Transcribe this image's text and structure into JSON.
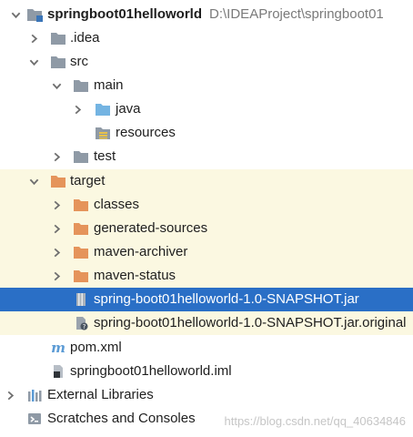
{
  "colors": {
    "folder": "#8f9aa6",
    "source_folder": "#74b4e2",
    "excluded_folder": "#e5945b",
    "selection": "#2a6fc6",
    "excluded_row": "#fbf8e1"
  },
  "tree": {
    "root": {
      "label": "springboot01helloworld",
      "path": "D:\\IDEAProject\\springboot01",
      "icon": "module-folder-icon"
    },
    "idea": {
      "label": ".idea",
      "icon": "folder-icon"
    },
    "src": {
      "label": "src",
      "icon": "folder-icon"
    },
    "main": {
      "label": "main",
      "icon": "folder-icon"
    },
    "java": {
      "label": "java",
      "icon": "source-folder-icon"
    },
    "resources": {
      "label": "resources",
      "icon": "resources-folder-icon"
    },
    "test": {
      "label": "test",
      "icon": "folder-icon"
    },
    "target": {
      "label": "target",
      "icon": "excluded-folder-icon"
    },
    "classes": {
      "label": "classes",
      "icon": "excluded-folder-icon"
    },
    "generated_sources": {
      "label": "generated-sources",
      "icon": "excluded-folder-icon"
    },
    "maven_archiver": {
      "label": "maven-archiver",
      "icon": "excluded-folder-icon"
    },
    "maven_status": {
      "label": "maven-status",
      "icon": "excluded-folder-icon"
    },
    "jar": {
      "label": "spring-boot01helloworld-1.0-SNAPSHOT.jar",
      "icon": "jar-file-icon"
    },
    "jar_original": {
      "label": "spring-boot01helloworld-1.0-SNAPSHOT.jar.original",
      "icon": "unknown-file-icon"
    },
    "pom": {
      "label": "pom.xml",
      "icon": "maven-icon"
    },
    "iml": {
      "label": "springboot01helloworld.iml",
      "icon": "iml-file-icon"
    },
    "external_libraries": {
      "label": "External Libraries",
      "icon": "libraries-icon"
    },
    "scratches": {
      "label": "Scratches and Consoles",
      "icon": "scratches-icon"
    }
  },
  "watermark": "https://blog.csdn.net/qq_40634846"
}
